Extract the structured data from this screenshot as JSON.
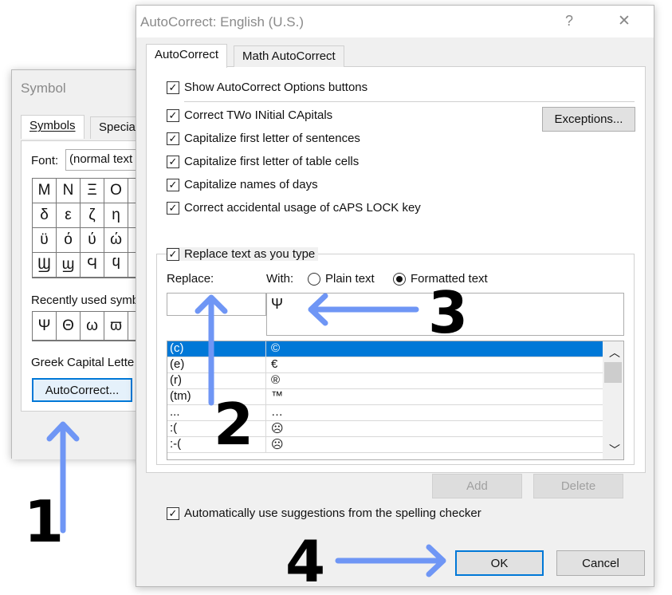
{
  "symbol_dialog": {
    "title": "Symbol",
    "tabs": [
      "Symbols",
      "Special"
    ],
    "font_label": "Font:",
    "font_value": "(normal text",
    "grid": [
      [
        "Μ",
        "Ν",
        "Ξ",
        "Ο"
      ],
      [
        "δ",
        "ε",
        "ζ",
        "η"
      ],
      [
        "ϋ",
        "ό",
        "ύ",
        "ώ"
      ],
      [
        "Ϣ",
        "ϣ",
        "Ϥ",
        "ϥ"
      ]
    ],
    "recent_label": "Recently used symb",
    "recent": [
      "Ψ",
      "Θ",
      "ω",
      "ϖ"
    ],
    "char_name": "Greek Capital Lette",
    "autocorrect_button": "AutoCorrect..."
  },
  "autocorrect_dialog": {
    "title": "AutoCorrect: English (U.S.)",
    "help": "?",
    "close": "✕",
    "tabs": [
      "AutoCorrect",
      "Math AutoCorrect"
    ],
    "show_options": "Show AutoCorrect Options buttons",
    "options": [
      "Correct TWo INitial CApitals",
      "Capitalize first letter of sentences",
      "Capitalize first letter of table cells",
      "Capitalize names of days",
      "Correct accidental usage of cAPS LOCK key"
    ],
    "exceptions_button": "Exceptions...",
    "replace_as_you_type": "Replace text as you type",
    "replace_label": "Replace:",
    "with_label": "With:",
    "plain_text": "Plain text",
    "formatted_text": "Formatted text",
    "format_selected": "formatted",
    "replace_value": "",
    "with_value": "Ψ",
    "entries": [
      [
        "(c)",
        "©"
      ],
      [
        "(e)",
        "€"
      ],
      [
        "(r)",
        "®"
      ],
      [
        "(tm)",
        "™"
      ],
      [
        "...",
        "…"
      ],
      [
        ":(",
        "☹"
      ],
      [
        ":-(",
        "☹"
      ]
    ],
    "add_button": "Add",
    "delete_button": "Delete",
    "auto_suggest": "Automatically use suggestions from the spelling checker",
    "ok_button": "OK",
    "cancel_button": "Cancel"
  },
  "annotations": {
    "labels": [
      "1",
      "2",
      "3",
      "4"
    ],
    "arrow_color": "#6f96f5"
  }
}
